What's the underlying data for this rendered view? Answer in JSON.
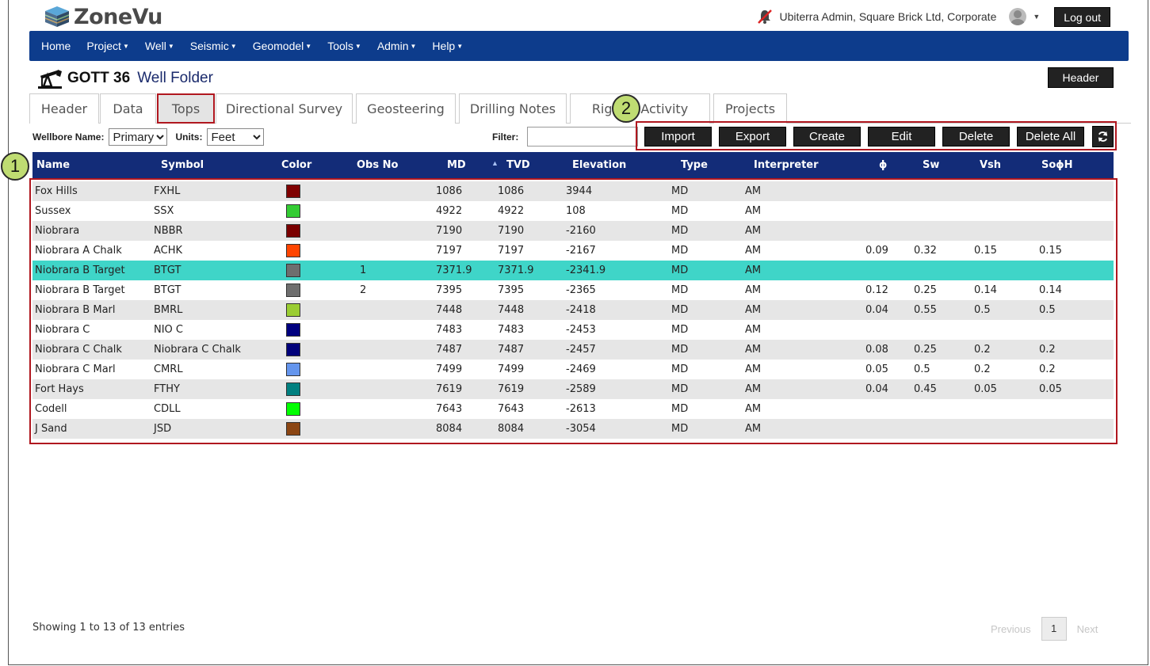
{
  "app": {
    "name": "ZoneVu"
  },
  "user": {
    "text": "Ubiterra Admin, Square Brick Ltd, Corporate",
    "logout_label": "Log out"
  },
  "nav": {
    "items": [
      {
        "label": "Home",
        "dropdown": false
      },
      {
        "label": "Project",
        "dropdown": true
      },
      {
        "label": "Well",
        "dropdown": true
      },
      {
        "label": "Seismic",
        "dropdown": true
      },
      {
        "label": "Geomodel",
        "dropdown": true
      },
      {
        "label": "Tools",
        "dropdown": true
      },
      {
        "label": "Admin",
        "dropdown": true
      },
      {
        "label": "Help",
        "dropdown": true
      }
    ]
  },
  "well": {
    "name": "GOTT 36",
    "folder_label": "Well Folder",
    "header_button": "Header"
  },
  "tabs": [
    {
      "label": "Header",
      "active": false
    },
    {
      "label": "Data",
      "active": false
    },
    {
      "label": "Tops",
      "active": true
    },
    {
      "label": "Directional Survey",
      "active": false
    },
    {
      "label": "Geosteering",
      "active": false
    },
    {
      "label": "Drilling Notes",
      "active": false
    },
    {
      "label": "RigSite Activity",
      "active": false
    },
    {
      "label": "Projects",
      "active": false
    }
  ],
  "controls": {
    "wellbore_label": "Wellbore Name:",
    "wellbore_value": "Primary",
    "units_label": "Units:",
    "units_value": "Feet",
    "filter_label": "Filter:",
    "filter_value": ""
  },
  "toolbar": {
    "import": "Import",
    "export": "Export",
    "create": "Create",
    "edit": "Edit",
    "delete": "Delete",
    "delete_all": "Delete All"
  },
  "callouts": {
    "one": "1",
    "two": "2"
  },
  "table": {
    "columns": [
      "Name",
      "Symbol",
      "Color",
      "Obs No",
      "MD",
      "TVD",
      "Elevation",
      "Type",
      "Interpreter",
      "ϕ",
      "Sw",
      "Vsh",
      "SoϕH"
    ],
    "sorted_column": "TVD",
    "rows": [
      {
        "name": "Fox Hills",
        "symbol": "FXHL",
        "color": "#7f0000",
        "obs": "",
        "md": "1086",
        "tvd": "1086",
        "elev": "3944",
        "type": "MD",
        "interp": "AM",
        "phi": "",
        "sw": "",
        "vsh": "",
        "sophih": ""
      },
      {
        "name": "Sussex",
        "symbol": "SSX",
        "color": "#33cc33",
        "obs": "",
        "md": "4922",
        "tvd": "4922",
        "elev": "108",
        "type": "MD",
        "interp": "AM",
        "phi": "",
        "sw": "",
        "vsh": "",
        "sophih": ""
      },
      {
        "name": "Niobrara",
        "symbol": "NBBR",
        "color": "#7a0000",
        "obs": "",
        "md": "7190",
        "tvd": "7190",
        "elev": "-2160",
        "type": "MD",
        "interp": "AM",
        "phi": "",
        "sw": "",
        "vsh": "",
        "sophih": ""
      },
      {
        "name": "Niobrara A Chalk",
        "symbol": "ACHK",
        "color": "#ff4500",
        "obs": "",
        "md": "7197",
        "tvd": "7197",
        "elev": "-2167",
        "type": "MD",
        "interp": "AM",
        "phi": "0.09",
        "sw": "0.32",
        "vsh": "0.15",
        "sophih": "0.15"
      },
      {
        "name": "Niobrara B Target",
        "symbol": "BTGT",
        "color": "#6e6e6e",
        "obs": "1",
        "md": "7371.9",
        "tvd": "7371.9",
        "elev": "-2341.9",
        "type": "MD",
        "interp": "AM",
        "phi": "",
        "sw": "",
        "vsh": "",
        "sophih": "",
        "selected": true
      },
      {
        "name": "Niobrara B Target",
        "symbol": "BTGT",
        "color": "#6e6e6e",
        "obs": "2",
        "md": "7395",
        "tvd": "7395",
        "elev": "-2365",
        "type": "MD",
        "interp": "AM",
        "phi": "0.12",
        "sw": "0.25",
        "vsh": "0.14",
        "sophih": "0.14"
      },
      {
        "name": "Niobrara B Marl",
        "symbol": "BMRL",
        "color": "#9acd32",
        "obs": "",
        "md": "7448",
        "tvd": "7448",
        "elev": "-2418",
        "type": "MD",
        "interp": "AM",
        "phi": "0.04",
        "sw": "0.55",
        "vsh": "0.5",
        "sophih": "0.5"
      },
      {
        "name": "Niobrara C",
        "symbol": "NIO C",
        "color": "#00007f",
        "obs": "",
        "md": "7483",
        "tvd": "7483",
        "elev": "-2453",
        "type": "MD",
        "interp": "AM",
        "phi": "",
        "sw": "",
        "vsh": "",
        "sophih": ""
      },
      {
        "name": "Niobrara C Chalk",
        "symbol": "Niobrara C Chalk",
        "color": "#00007a",
        "obs": "",
        "md": "7487",
        "tvd": "7487",
        "elev": "-2457",
        "type": "MD",
        "interp": "AM",
        "phi": "0.08",
        "sw": "0.25",
        "vsh": "0.2",
        "sophih": "0.2"
      },
      {
        "name": "Niobrara C Marl",
        "symbol": "CMRL",
        "color": "#6495ed",
        "obs": "",
        "md": "7499",
        "tvd": "7499",
        "elev": "-2469",
        "type": "MD",
        "interp": "AM",
        "phi": "0.05",
        "sw": "0.5",
        "vsh": "0.2",
        "sophih": "0.2"
      },
      {
        "name": "Fort Hays",
        "symbol": "FTHY",
        "color": "#008080",
        "obs": "",
        "md": "7619",
        "tvd": "7619",
        "elev": "-2589",
        "type": "MD",
        "interp": "AM",
        "phi": "0.04",
        "sw": "0.45",
        "vsh": "0.05",
        "sophih": "0.05"
      },
      {
        "name": "Codell",
        "symbol": "CDLL",
        "color": "#00ff00",
        "obs": "",
        "md": "7643",
        "tvd": "7643",
        "elev": "-2613",
        "type": "MD",
        "interp": "AM",
        "phi": "",
        "sw": "",
        "vsh": "",
        "sophih": ""
      },
      {
        "name": "J Sand",
        "symbol": "JSD",
        "color": "#8b4513",
        "obs": "",
        "md": "8084",
        "tvd": "8084",
        "elev": "-3054",
        "type": "MD",
        "interp": "AM",
        "phi": "",
        "sw": "",
        "vsh": "",
        "sophih": ""
      }
    ]
  },
  "footer": {
    "info": "Showing 1 to 13 of 13 entries",
    "previous": "Previous",
    "page": "1",
    "next": "Next"
  },
  "colors": {
    "nav": "#0d3c8c",
    "table_header": "#132c78",
    "selected_row": "#3fd5c8",
    "highlight_box": "#b0171f",
    "callout": "#bfdc72"
  }
}
